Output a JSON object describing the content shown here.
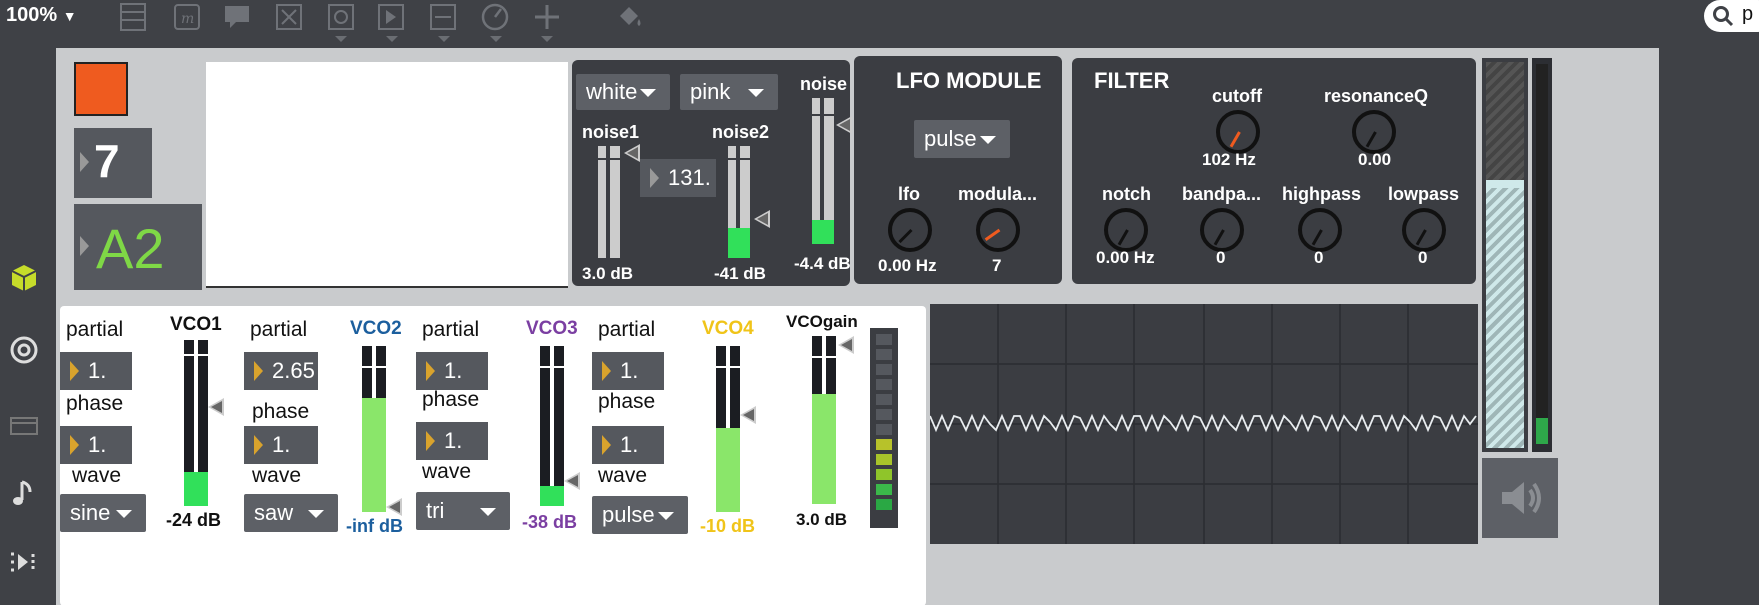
{
  "toolbar": {
    "zoom": "100%",
    "search_text": "p"
  },
  "header": {
    "number_display": "7",
    "note_display": "A2",
    "color_swatch": "#ef5b1f"
  },
  "noise": {
    "menu1": "white",
    "menu2": "pink",
    "label1": "noise1",
    "label2": "noise2",
    "label3": "noise",
    "freq_value": "131.",
    "db1": "3.0 dB",
    "db2": "-41 dB",
    "db3": "-4.4 dB"
  },
  "lfo": {
    "title": "LFO MODULE",
    "shape": "pulse",
    "lfo_label": "lfo",
    "mod_label": "modula...",
    "lfo_value": "0.00 Hz",
    "mod_value": "7"
  },
  "filter": {
    "title": "FILTER",
    "cutoff_label": "cutoff",
    "cutoff_value": "102 Hz",
    "resonance_label": "resonanceQ",
    "resonance_value": "0.00",
    "notch_label": "notch",
    "notch_value": "0.00 Hz",
    "bandpass_label": "bandpa...",
    "bandpass_value": "0",
    "highpass_label": "highpass",
    "highpass_value": "0",
    "lowpass_label": "lowpass",
    "lowpass_value": "0"
  },
  "vco": [
    {
      "name": "VCO1",
      "color": "#111111",
      "partial": "1.",
      "phase": "1.",
      "wave": "sine",
      "db": "-24 dB",
      "db_color": "#111111"
    },
    {
      "name": "VCO2",
      "color": "#1c5f9e",
      "partial": "2.65",
      "phase": "1.",
      "wave": "saw",
      "db": "-inf dB",
      "db_color": "#1c5f9e"
    },
    {
      "name": "VCO3",
      "color": "#7b3fa2",
      "partial": "1.",
      "phase": "1.",
      "wave": "tri",
      "db": "-38 dB",
      "db_color": "#7b3fa2"
    },
    {
      "name": "VCO4",
      "color": "#f0c419",
      "partial": "1.",
      "phase": "1.",
      "wave": "pulse",
      "db": "-10 dB",
      "db_color": "#f0c419"
    }
  ],
  "labels": {
    "partial": "partial",
    "phase": "phase",
    "wave": "wave"
  },
  "vcogain": {
    "label": "VCOgain",
    "db": "3.0 dB"
  }
}
